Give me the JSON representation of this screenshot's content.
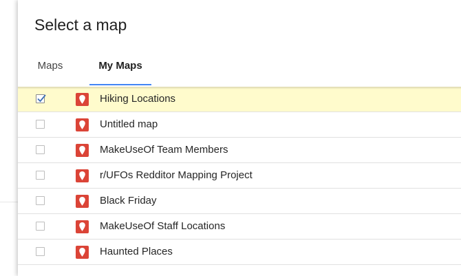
{
  "dialog": {
    "title": "Select a map"
  },
  "tabs": [
    {
      "label": "Maps",
      "active": false
    },
    {
      "label": "My Maps",
      "active": true
    }
  ],
  "colors": {
    "accent": "#4285f4",
    "selected_row": "#fffbcc",
    "map_icon": "#db4437"
  },
  "icons": {
    "checkbox_checked": "checkmark-icon",
    "map": "map-pin-icon"
  },
  "maps": [
    {
      "name": "Hiking Locations",
      "checked": true
    },
    {
      "name": "Untitled map",
      "checked": false
    },
    {
      "name": "MakeUseOf Team Members",
      "checked": false
    },
    {
      "name": "r/UFOs Redditor Mapping Project",
      "checked": false
    },
    {
      "name": "Black Friday",
      "checked": false
    },
    {
      "name": "MakeUseOf Staff Locations",
      "checked": false
    },
    {
      "name": "Haunted Places",
      "checked": false
    }
  ]
}
